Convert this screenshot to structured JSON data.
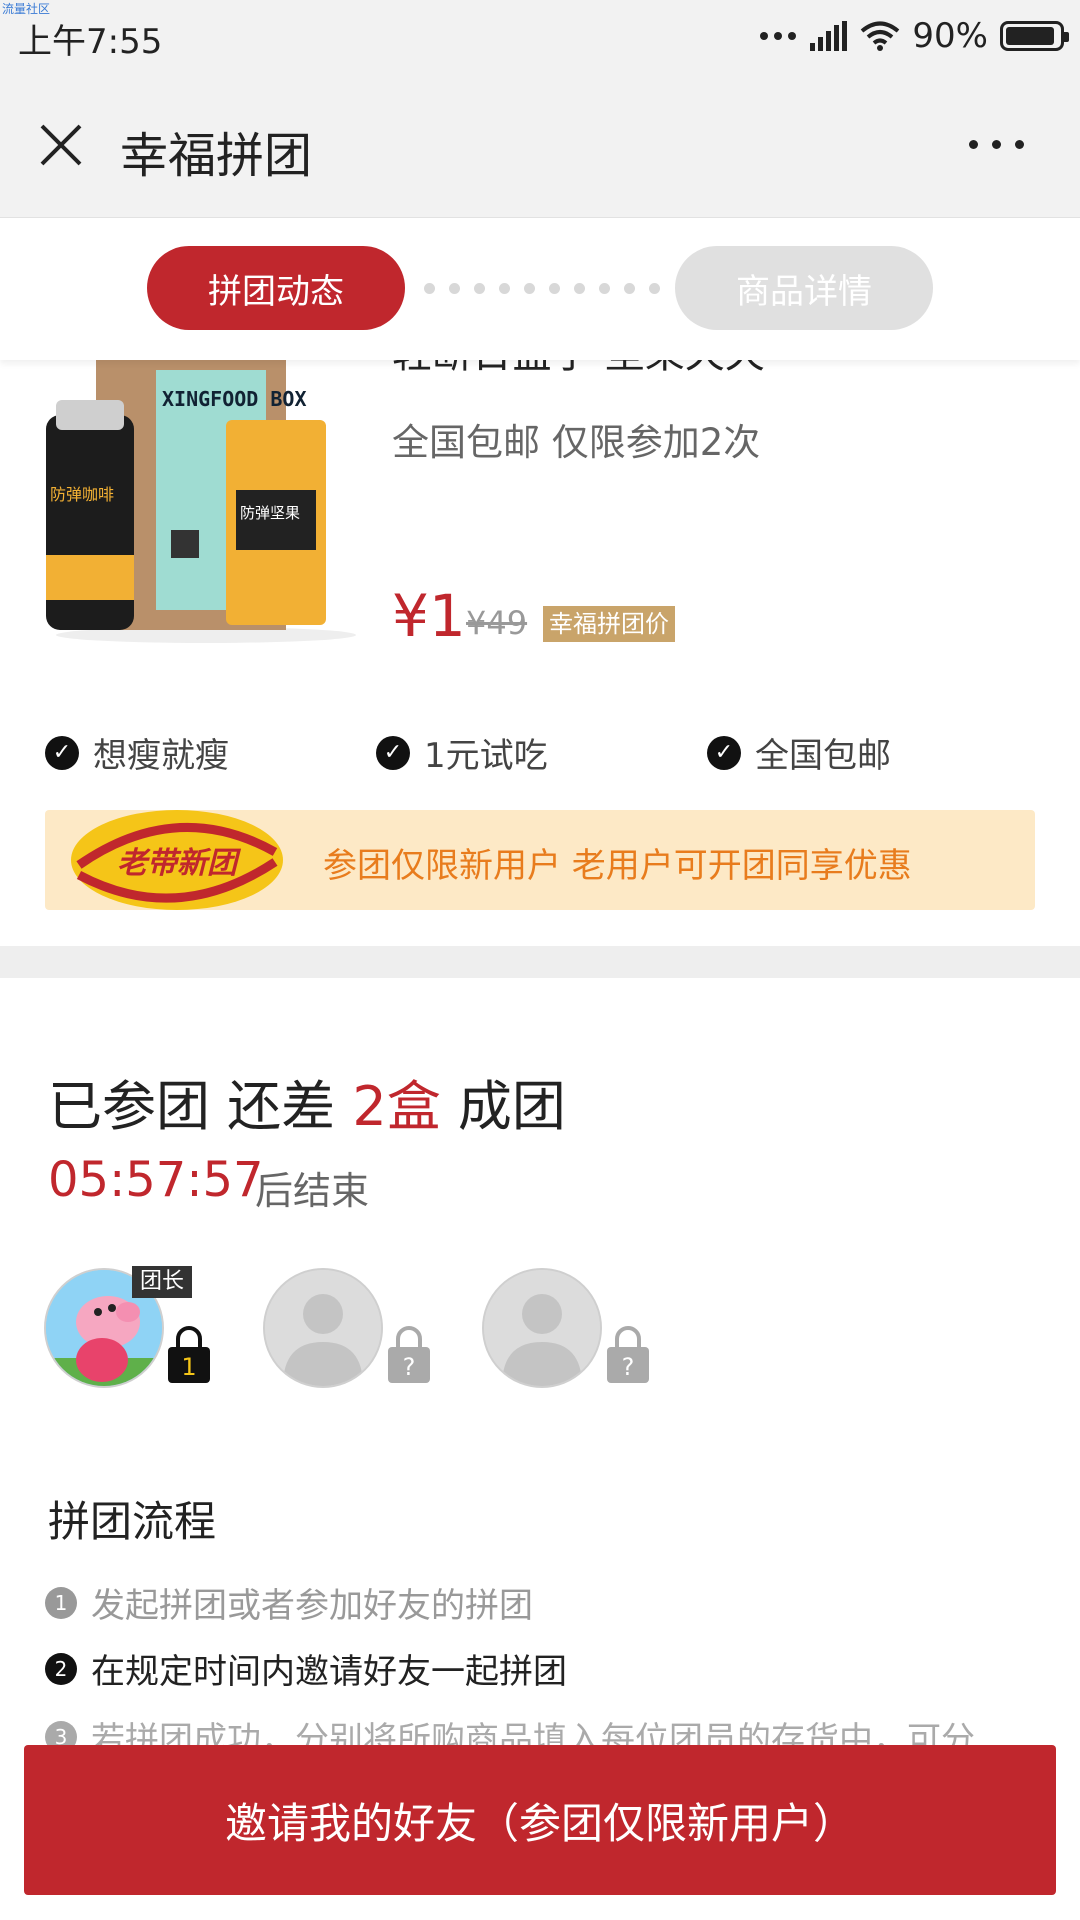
{
  "status_bar": {
    "watermark": "流量社区",
    "time": "上午7:55",
    "battery": "90%"
  },
  "titlebar": {
    "title": "幸福拼团"
  },
  "tabs": {
    "active": "拼团动态",
    "inactive": "商品详情"
  },
  "product": {
    "title": "轻断日盒子·坚果天天",
    "subtitle": "全国包邮 仅限参加2次",
    "price": "¥1",
    "old_price": "¥49",
    "price_tag": "幸福拼团价",
    "image_labels": {
      "box": "XINGFOOD BOX",
      "coffee": "防弹咖啡",
      "nuts": "防弹坚果"
    }
  },
  "features": [
    "想瘦就瘦",
    "1元试吃",
    "全国包邮"
  ],
  "banner": {
    "badge": "老带新团",
    "text": "参团仅限新用户 老用户可开团同享优惠"
  },
  "group": {
    "status_prefix": "已参团 还差 ",
    "status_highlight": "2盒",
    "status_suffix": " 成团",
    "countdown": "05:57:57",
    "countdown_suffix": "后结束",
    "leader_tag": "团长",
    "leader_count": "1",
    "empty_mark": "?"
  },
  "process": {
    "title": "拼团流程",
    "steps": [
      {
        "num": "1",
        "text": "发起拼团或者参加好友的拼团"
      },
      {
        "num": "2",
        "text": "在规定时间内邀请好友一起拼团"
      },
      {
        "num": "3",
        "text": "若拼团成功，分别将所购商品填入每位团员的存货中，可分"
      }
    ]
  },
  "cta": {
    "label": "邀请我的好友（参团仅限新用户）"
  },
  "colors": {
    "accent": "#c0272d",
    "banner_bg": "#fde9c6",
    "banner_text": "#e87c1d",
    "price_tag": "#c9a46a"
  }
}
